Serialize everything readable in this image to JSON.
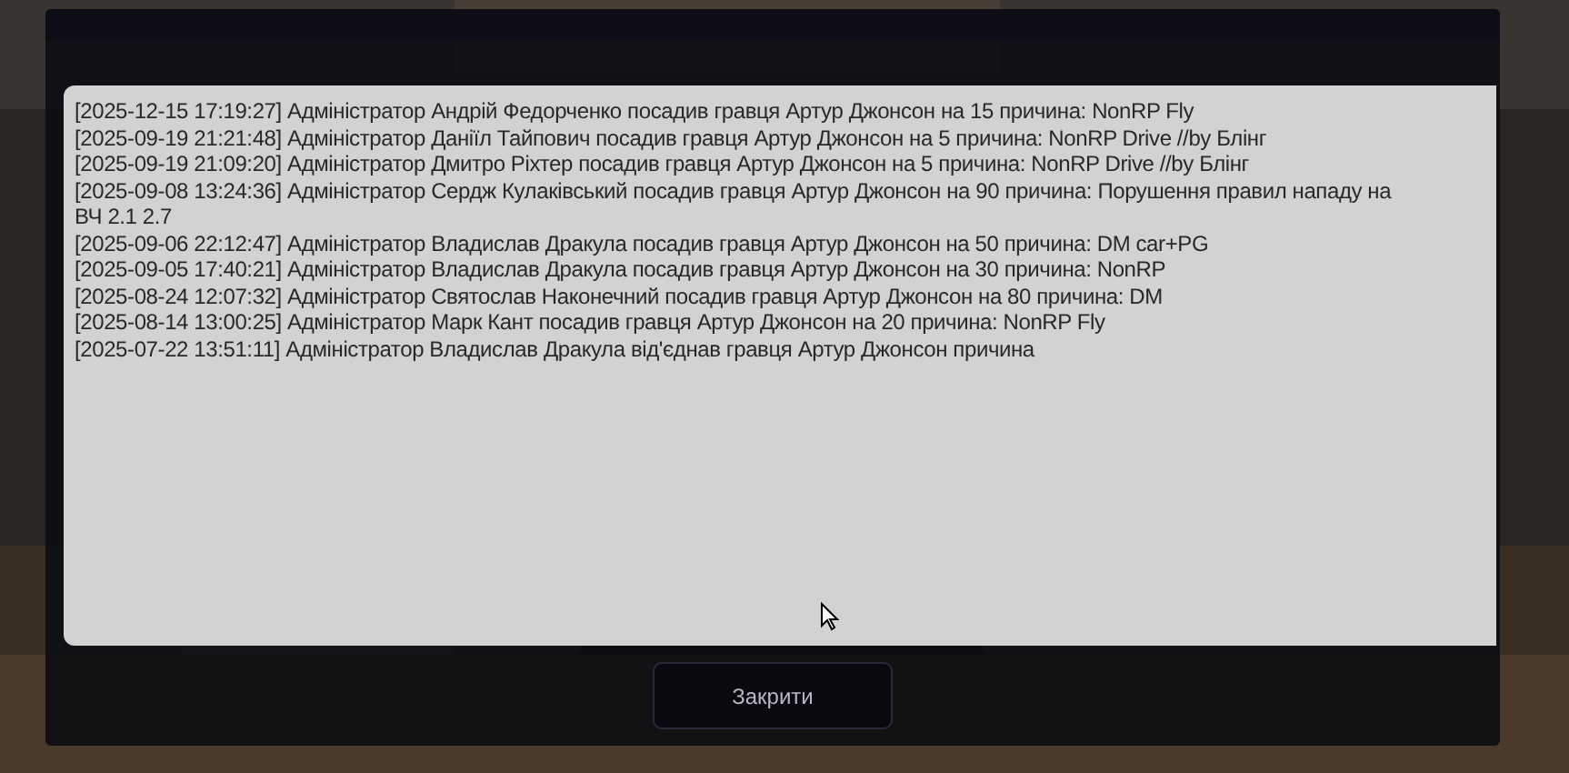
{
  "log": {
    "lines": [
      "[2025-12-15 17:19:27] Адміністратор Андрій Федорченко посадив гравця Артур Джонсон на 15 причина: NonRP Fly",
      "[2025-09-19 21:21:48] Адміністратор Даніїл Тайпович посадив гравця Артур Джонсон на 5 причина: NonRP Drive //by Блінг",
      "[2025-09-19 21:09:20] Адміністратор Дмитро Ріхтер посадив гравця Артур Джонсон на 5 причина: NonRP Drive //by Блінг",
      "[2025-09-08 13:24:36] Адміністратор Сердж Кулаківський посадив гравця Артур Джонсон на 90 причина: Порушення правил нападу на",
      "ВЧ 2.1 2.7",
      "[2025-09-06 22:12:47] Адміністратор Владислав Дракула посадив гравця Артур Джонсон на 50 причина: DM car+PG",
      "[2025-09-05 17:40:21] Адміністратор Владислав Дракула посадив гравця Артур Джонсон на 30 причина: NonRP",
      "[2025-08-24 12:07:32] Адміністратор Святослав Наконечний посадив гравця Артур Джонсон на 80 причина: DM",
      "[2025-08-14 13:00:25] Адміністратор Марк Кант посадив гравця Артур Джонсон на 20 причина: NonRP Fly",
      "[2025-07-22 13:51:11] Адміністратор Владислав Дракула від'єднав гравця Артур Джонсон причина"
    ]
  },
  "close_button": "Закрити"
}
